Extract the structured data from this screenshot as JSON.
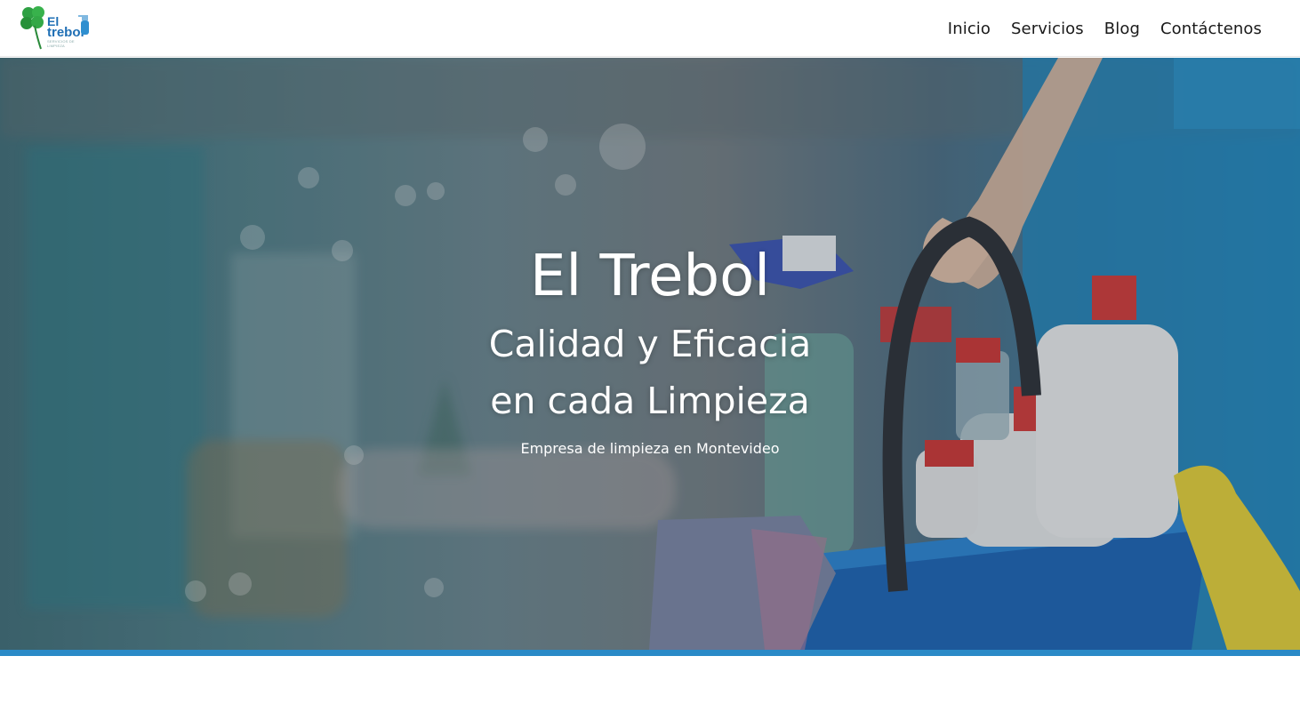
{
  "logo": {
    "line1": "El",
    "line2": "trebol",
    "tagline": "SERVICIOS DE LIMPIEZA"
  },
  "nav": {
    "items": [
      "Inicio",
      "Servicios",
      "Blog",
      "Contáctenos"
    ]
  },
  "hero": {
    "title": "El Trebol",
    "subtitle_line1": "Calidad y Eficacia",
    "subtitle_line2": "en cada Limpieza",
    "tagline": "Empresa de limpieza en Montevideo"
  },
  "colors": {
    "accent_bar": "#2a8ac7",
    "logo_blue": "#1f6fb5",
    "clover_green": "#2ea043"
  },
  "icons": [
    "clover-icon",
    "spray-bottle-icon"
  ]
}
